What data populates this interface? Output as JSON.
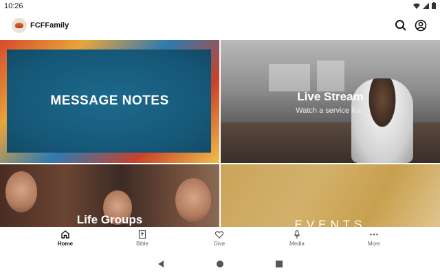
{
  "status_bar": {
    "time": "10:26"
  },
  "app": {
    "name": "FCFFamily"
  },
  "tiles": [
    {
      "title": "MESSAGE NOTES"
    },
    {
      "title": "Live Stream",
      "subtitle": "Watch a service live."
    },
    {
      "title": "Life Groups"
    },
    {
      "title": "EVENTS"
    }
  ],
  "bottom_nav": [
    {
      "label": "Home",
      "icon": "home-icon",
      "active": true
    },
    {
      "label": "Bible",
      "icon": "bible-icon",
      "active": false
    },
    {
      "label": "Give",
      "icon": "heart-icon",
      "active": false
    },
    {
      "label": "Media",
      "icon": "microphone-icon",
      "active": false
    },
    {
      "label": "More",
      "icon": "more-dots-icon",
      "active": false
    }
  ],
  "colors": {
    "accent": "#165777",
    "text": "#111111"
  }
}
